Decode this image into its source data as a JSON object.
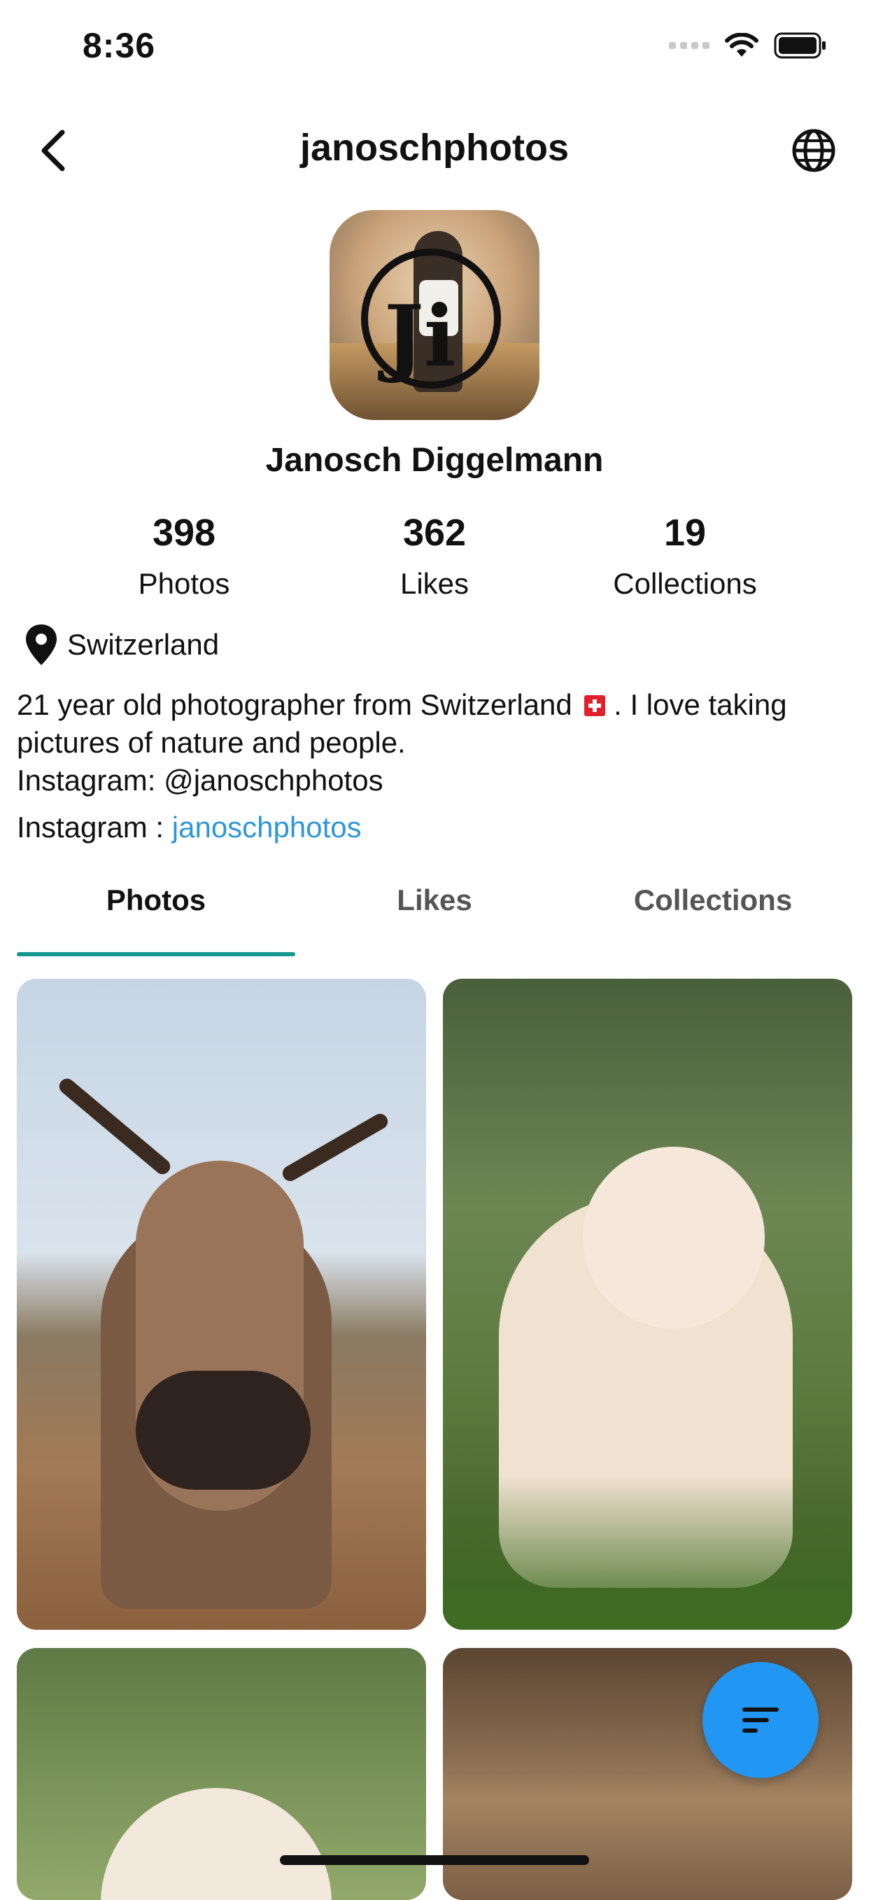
{
  "status_bar": {
    "time": "8:36",
    "icons": [
      "cellular-signal-icon",
      "wifi-icon",
      "battery-icon"
    ]
  },
  "header": {
    "title": "janoschphotos",
    "back_icon": "chevron-left-icon",
    "globe_icon": "globe-icon"
  },
  "profile": {
    "name": "Janosch Diggelmann",
    "stats": [
      {
        "value": "398",
        "label": "Photos"
      },
      {
        "value": "362",
        "label": "Likes"
      },
      {
        "value": "19",
        "label": "Collections"
      }
    ],
    "location": "Switzerland",
    "bio_line1_a": "21 year old photographer from Switzerland",
    "bio_line1_b": " . I love taking",
    "bio_line2": "pictures of nature and people.",
    "bio_line3": "Instagram: @janoschphotos",
    "instagram_prefix": "Instagram : ",
    "instagram_handle": "janoschphotos"
  },
  "tabs": [
    {
      "label": "Photos",
      "active": true
    },
    {
      "label": "Likes",
      "active": false
    },
    {
      "label": "Collections",
      "active": false
    }
  ],
  "photos": [
    "cow",
    "dog",
    "dog",
    "wood"
  ],
  "fab": {
    "icon": "sort-icon"
  },
  "colors": {
    "accent": "#12988f",
    "link": "#2f97d8",
    "fab": "#2196f3"
  }
}
